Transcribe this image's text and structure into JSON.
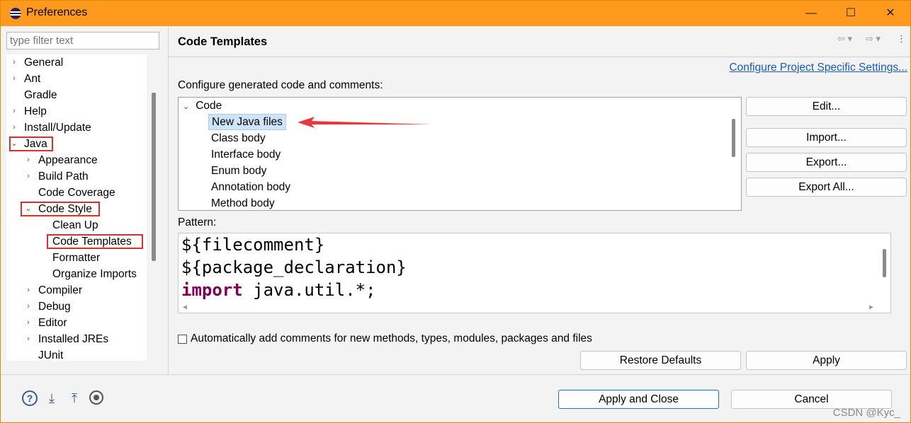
{
  "window": {
    "title": "Preferences",
    "minimize": "—",
    "maximize": "☐",
    "close": "✕"
  },
  "filter": {
    "placeholder": "type filter text"
  },
  "tree": {
    "items": [
      {
        "label": "General",
        "twisty": "›"
      },
      {
        "label": "Ant",
        "twisty": "›"
      },
      {
        "label": "Gradle",
        "twisty": ""
      },
      {
        "label": "Help",
        "twisty": "›"
      },
      {
        "label": "Install/Update",
        "twisty": "›"
      },
      {
        "label": "Java",
        "twisty": "⌄"
      },
      {
        "label": "Appearance",
        "twisty": "›"
      },
      {
        "label": "Build Path",
        "twisty": "›"
      },
      {
        "label": "Code Coverage",
        "twisty": ""
      },
      {
        "label": "Code Style",
        "twisty": "⌄"
      },
      {
        "label": "Clean Up",
        "twisty": ""
      },
      {
        "label": "Code Templates",
        "twisty": ""
      },
      {
        "label": "Formatter",
        "twisty": ""
      },
      {
        "label": "Organize Imports",
        "twisty": ""
      },
      {
        "label": "Compiler",
        "twisty": "›"
      },
      {
        "label": "Debug",
        "twisty": "›"
      },
      {
        "label": "Editor",
        "twisty": "›"
      },
      {
        "label": "Installed JREs",
        "twisty": "›"
      },
      {
        "label": "JUnit",
        "twisty": ""
      }
    ]
  },
  "page": {
    "title": "Code Templates",
    "nav_back": "⇦ ▾",
    "nav_forward": "⇨ ▾",
    "nav_menu": "⋮",
    "configure_link": "Configure Project Specific Settings...",
    "configure_label": "Configure generated code and comments:",
    "code_root": {
      "twisty": "⌄",
      "label": "Code"
    },
    "code_items": [
      "New Java files",
      "Class body",
      "Interface body",
      "Enum body",
      "Annotation body",
      "Method body"
    ],
    "buttons": {
      "edit": "Edit...",
      "import": "Import...",
      "export": "Export...",
      "export_all": "Export All..."
    },
    "pattern_label": "Pattern:",
    "pattern_lines": [
      "${filecomment}",
      "${package_declaration}",
      "java.util.*;"
    ],
    "pattern_keyword": "import",
    "scroll_left": "◀",
    "scroll_right": "▶",
    "auto_comments_label": "Automatically add comments for new methods, types, modules, packages and files",
    "restore_defaults": "Restore Defaults",
    "apply": "Apply"
  },
  "footer": {
    "help_glyph": "?",
    "import_glyph": "⤓",
    "export_glyph": "⤒",
    "apply_close": "Apply and Close",
    "cancel": "Cancel",
    "watermark": "CSDN @Kyc_"
  },
  "colors": {
    "titlebar": "#ff9a1f",
    "highlight_box": "#e22d2d",
    "link": "#1a5ab8",
    "keyword": "#7f0055",
    "selection": "#cfe4f7"
  }
}
